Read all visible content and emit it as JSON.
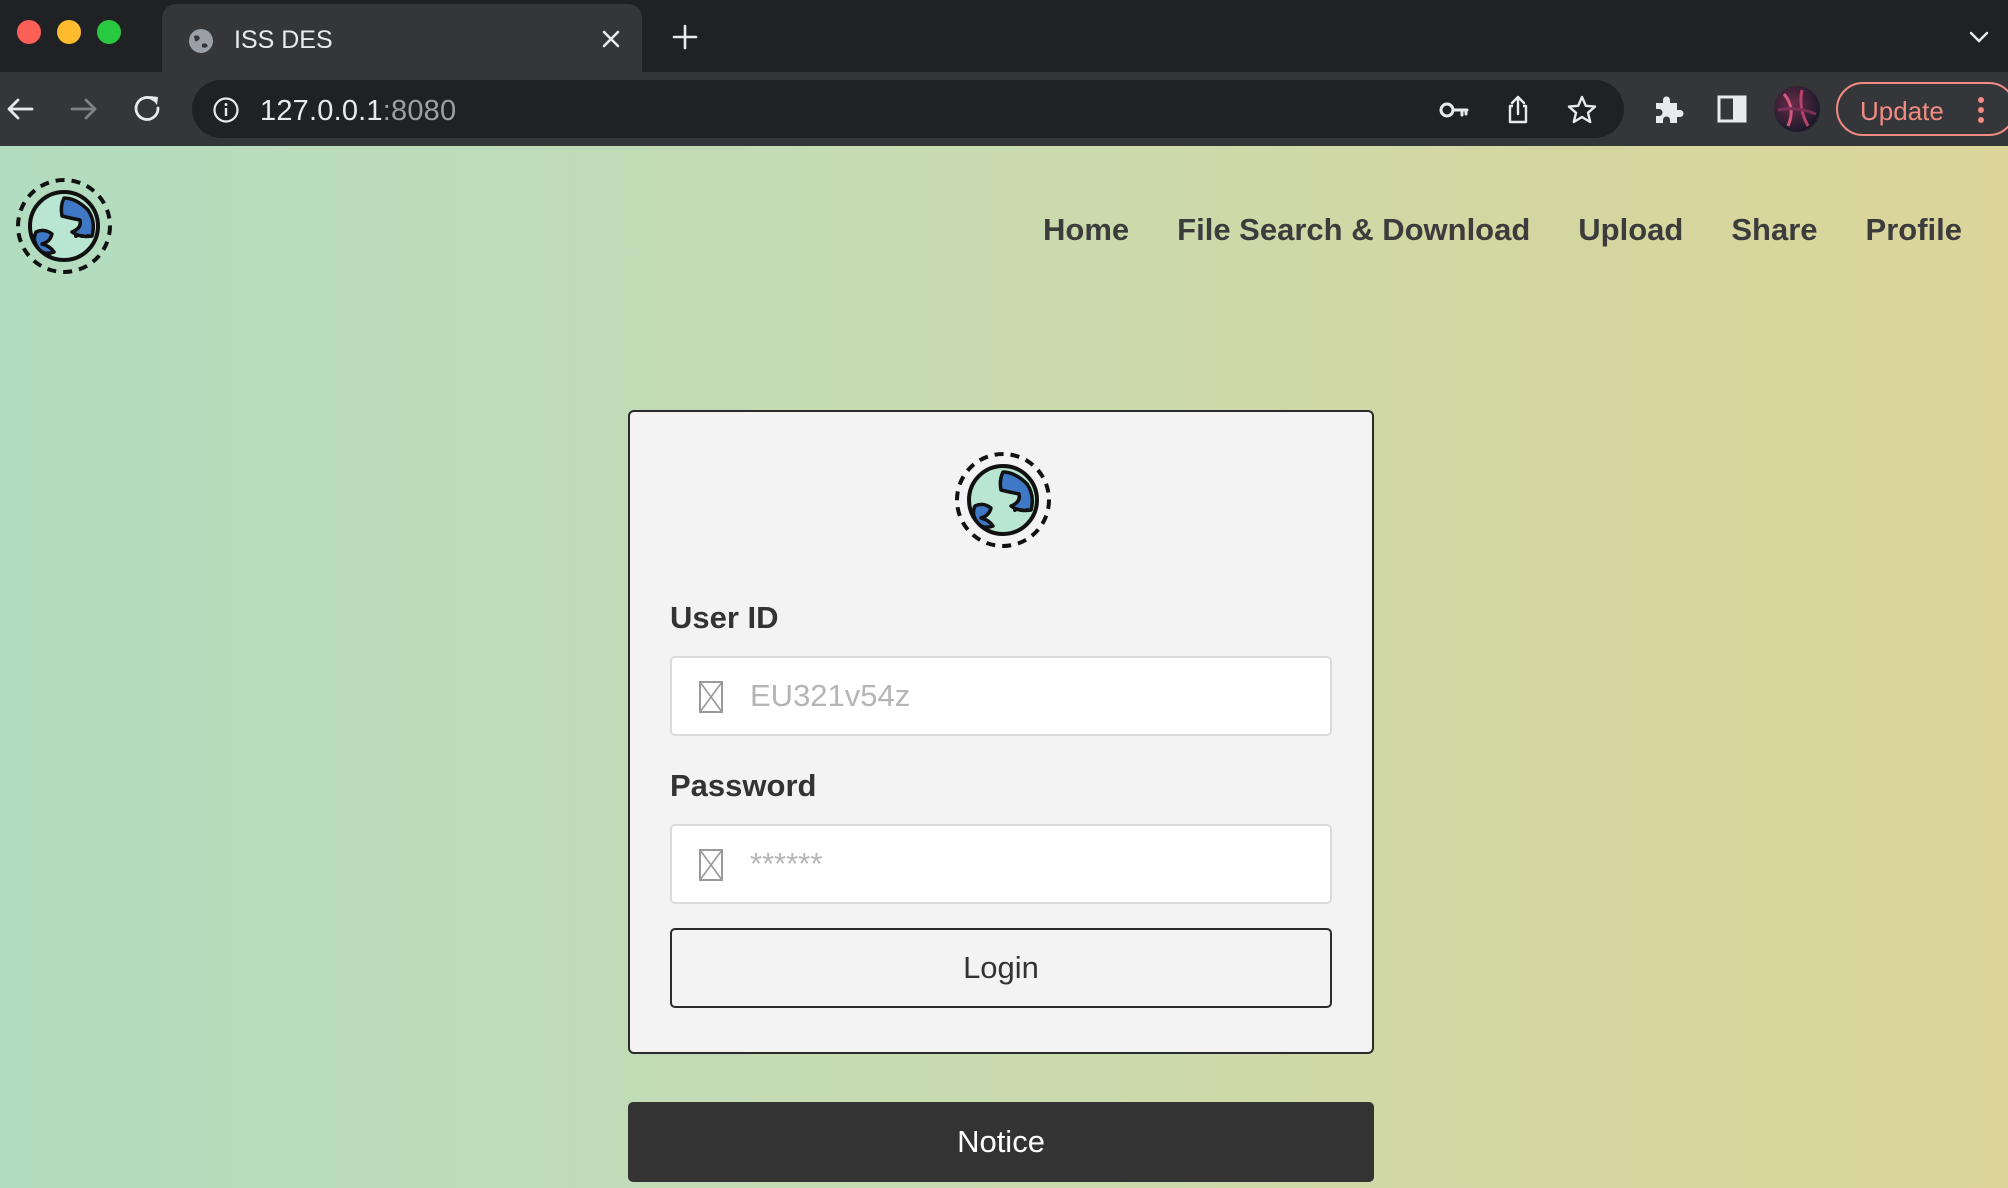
{
  "browser": {
    "tab": {
      "title": "ISS DES"
    },
    "address": {
      "host": "127.0.0.1",
      "port": ":8080"
    },
    "update_label": "Update"
  },
  "site": {
    "nav": [
      {
        "label": "Home"
      },
      {
        "label": "File Search & Download"
      },
      {
        "label": "Upload"
      },
      {
        "label": "Share"
      },
      {
        "label": "Profile"
      }
    ]
  },
  "login": {
    "user_label": "User ID",
    "user_placeholder": "EU321v54z",
    "password_label": "Password",
    "password_placeholder": "******",
    "login_label": "Login"
  },
  "notice_label": "Notice",
  "colors": {
    "accent_update": "#f28b82",
    "notice_bg": "#333333",
    "card_bg": "#f3f3f3"
  }
}
